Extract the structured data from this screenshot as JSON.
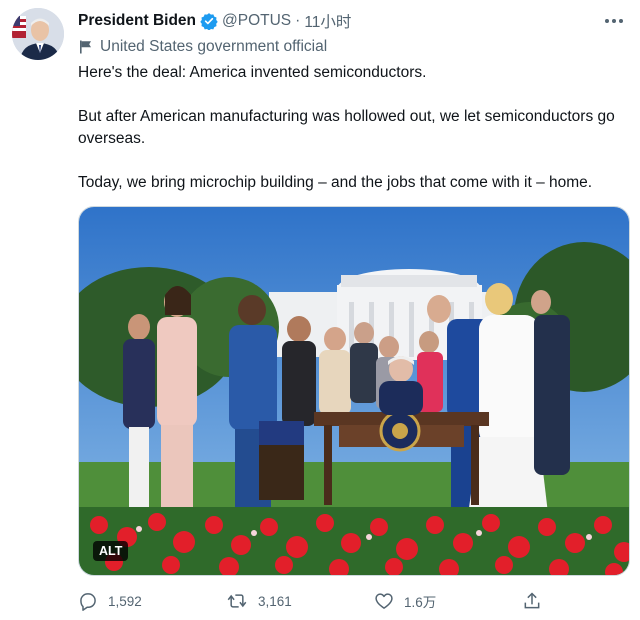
{
  "author": {
    "display_name": "President Biden",
    "handle": "@POTUS",
    "separator": "·",
    "time": "11小时",
    "label": "United States government official"
  },
  "tweet": {
    "paragraphs": [
      "Here's the deal: America invented semiconductors.",
      "But after American manufacturing was hollowed out, we let semiconductors go overseas.",
      "Today, we bring microchip building – and the jobs that come with it – home."
    ]
  },
  "media": {
    "alt_label": "ALT"
  },
  "actions": {
    "replies": "1,592",
    "retweets": "3,161",
    "likes": "1.6万"
  },
  "colors": {
    "text": "#0f1419",
    "secondary": "#536471",
    "verified": "#1d9bf0"
  },
  "icons": {
    "verified": "verified-badge-icon",
    "label": "government-flag-icon",
    "more": "more-icon",
    "reply": "reply-icon",
    "retweet": "retweet-icon",
    "like": "heart-icon",
    "share": "share-icon"
  }
}
